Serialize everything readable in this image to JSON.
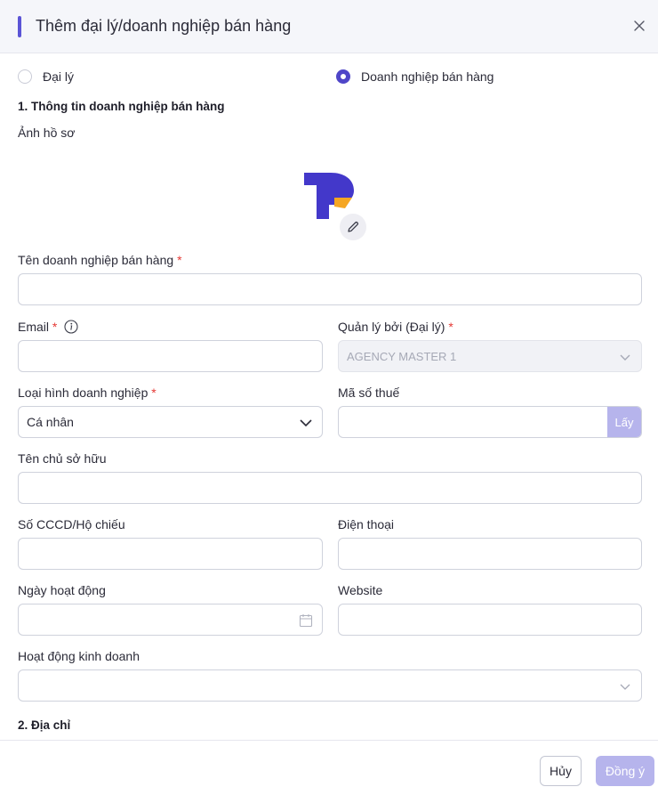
{
  "dialog": {
    "title": "Thêm đại lý/doanh nghiệp bán hàng",
    "close_icon": "close-icon"
  },
  "type_options": [
    {
      "label": "Đại lý",
      "selected": false
    },
    {
      "label": "Doanh nghiệp bán hàng",
      "selected": true
    }
  ],
  "section1": {
    "title": "1. Thông tin doanh nghiệp bán hàng",
    "avatar_label": "Ảnh hồ sơ"
  },
  "fields": {
    "business_name": {
      "label": "Tên doanh nghiệp bán hàng",
      "required": "*",
      "value": ""
    },
    "email": {
      "label": "Email",
      "required": "*",
      "value": ""
    },
    "managed_by": {
      "label": "Quản lý bởi (Đại lý)",
      "required": "*",
      "value": "AGENCY MASTER 1"
    },
    "business_type": {
      "label": "Loại hình doanh nghiệp",
      "required": "*",
      "value": "Cá nhân"
    },
    "tax_code": {
      "label": "Mã số thuế",
      "value": "",
      "button": "Lấy"
    },
    "owner_name": {
      "label": "Tên chủ sở hữu",
      "value": ""
    },
    "id_number": {
      "label": "Số CCCD/Hộ chiếu",
      "value": ""
    },
    "phone": {
      "label": "Điện thoại",
      "value": ""
    },
    "start_date": {
      "label": "Ngày hoạt động",
      "value": ""
    },
    "website": {
      "label": "Website",
      "value": ""
    },
    "business_activity": {
      "label": "Hoạt động kinh doanh",
      "value": ""
    }
  },
  "section2": {
    "title": "2. Địa chỉ"
  },
  "footer": {
    "cancel_label": "Hủy",
    "ok_label": "Đồng ý"
  },
  "colors": {
    "accent": "#5b54d6",
    "disabled_button": "#b6b4ec",
    "required": "#e53935",
    "logo_blue": "#4338ca",
    "logo_orange": "#f5a623"
  }
}
